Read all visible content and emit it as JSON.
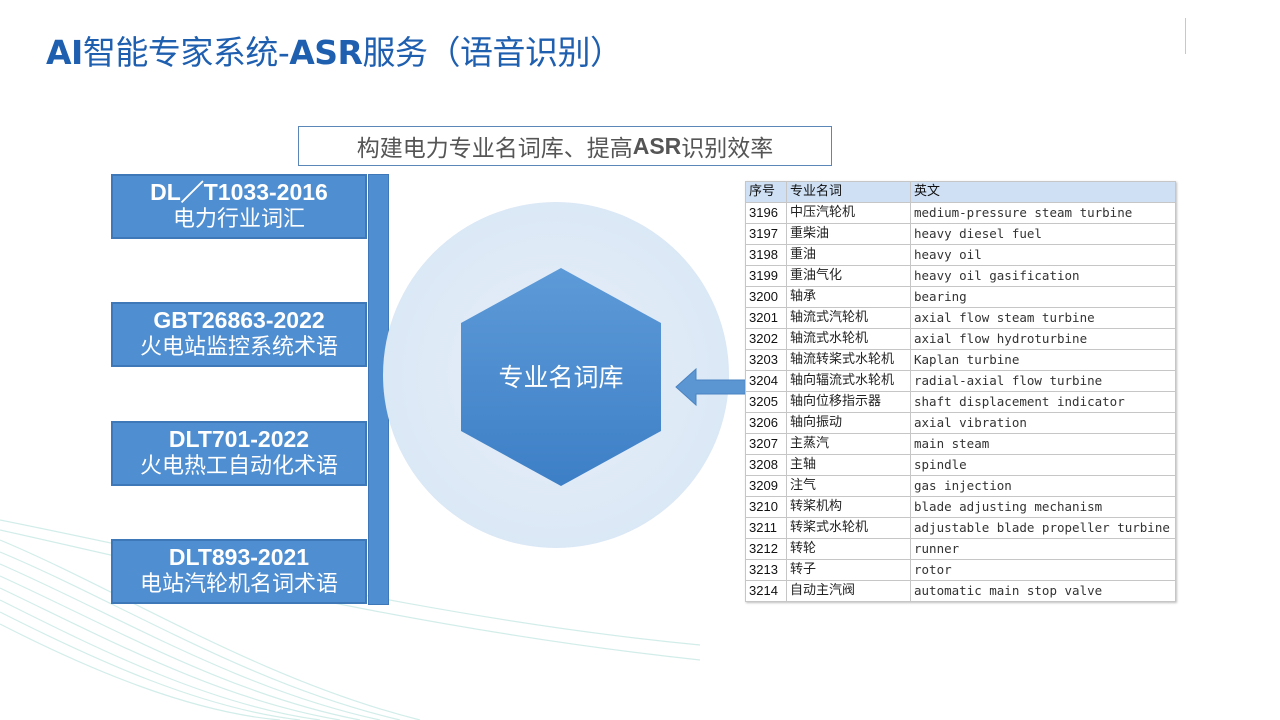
{
  "title": {
    "part1": "AI",
    "part2": "智能专家系统-",
    "part3": "ASR",
    "part4": "服务（语音识别）"
  },
  "subtitle": {
    "part1": "构建电力专业名词库、提高",
    "part2": "ASR",
    "part3": "识别效率"
  },
  "standards": [
    {
      "code": "DL／T1033-2016",
      "name": "电力行业词汇"
    },
    {
      "code": "GBT26863-2022",
      "name": "火电站监控系统术语"
    },
    {
      "code": "DLT701-2022",
      "name": "火电热工自动化术语"
    },
    {
      "code": "DLT893-2021",
      "name": "电站汽轮机名词术语"
    }
  ],
  "center": {
    "label": "专业名词库"
  },
  "glossary": {
    "headers": [
      "序号",
      "专业名词",
      "英文"
    ],
    "rows": [
      [
        "3196",
        "中压汽轮机",
        "medium-pressure steam turbine"
      ],
      [
        "3197",
        "重柴油",
        "heavy diesel fuel"
      ],
      [
        "3198",
        "重油",
        "heavy oil"
      ],
      [
        "3199",
        "重油气化",
        "heavy oil gasification"
      ],
      [
        "3200",
        "轴承",
        "bearing"
      ],
      [
        "3201",
        "轴流式汽轮机",
        "axial flow steam turbine"
      ],
      [
        "3202",
        "轴流式水轮机",
        "axial flow hydroturbine"
      ],
      [
        "3203",
        "轴流转桨式水轮机",
        "Kaplan turbine"
      ],
      [
        "3204",
        "轴向辐流式水轮机",
        "radial-axial flow turbine"
      ],
      [
        "3205",
        "轴向位移指示器",
        "shaft displacement indicator"
      ],
      [
        "3206",
        "轴向振动",
        "axial vibration"
      ],
      [
        "3207",
        "主蒸汽",
        "main steam"
      ],
      [
        "3208",
        "主轴",
        "spindle"
      ],
      [
        "3209",
        "注气",
        "gas injection"
      ],
      [
        "3210",
        "转桨机构",
        "blade adjusting mechanism"
      ],
      [
        "3211",
        "转桨式水轮机",
        "adjustable blade propeller turbine"
      ],
      [
        "3212",
        "转轮",
        "runner"
      ],
      [
        "3213",
        "转子",
        "rotor"
      ],
      [
        "3214",
        "自动主汽阀",
        "automatic main stop valve"
      ]
    ]
  },
  "colors": {
    "title_blue": "#1f5fb0",
    "box_blue": "#4f8ed0",
    "table_header": "#cfe0f5"
  }
}
